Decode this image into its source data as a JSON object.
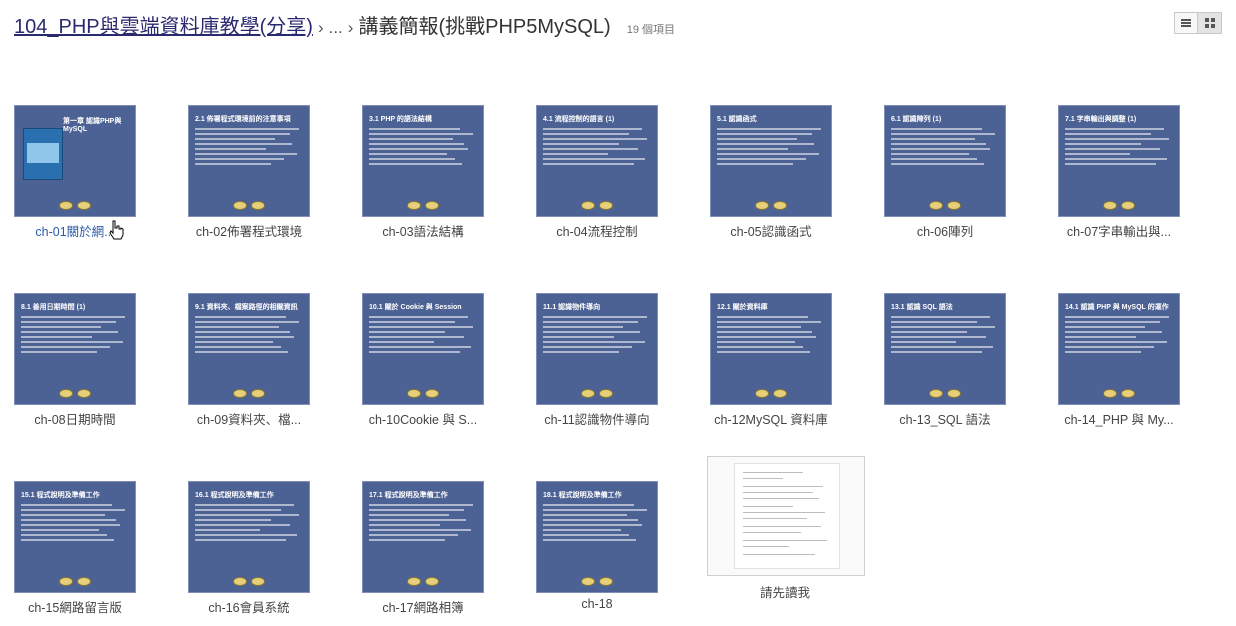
{
  "header": {
    "parent": "104_PHP與雲端資料庫教學(分享)",
    "sep1": "›",
    "ellipsis": "...",
    "sep2": "›",
    "current": "講義簡報(挑戰PHP5MySQL)",
    "count": "19 個項目"
  },
  "view_modes": {
    "active": "grid",
    "icons": [
      "list-view-icon",
      "grid-view-icon"
    ]
  },
  "slides": [
    {
      "label": "ch-01關於網...",
      "title": "第一章 認識PHP與MySQL"
    },
    {
      "label": "ch-02佈署程式環境",
      "title": "2.1 佈署程式環境前的注意事項"
    },
    {
      "label": "ch-03語法結構",
      "title": "3.1 PHP 的語法結構"
    },
    {
      "label": "ch-04流程控制",
      "title": "4.1 流程控制的語言 (1)"
    },
    {
      "label": "ch-05認識函式",
      "title": "5.1 認識函式"
    },
    {
      "label": "ch-06陣列",
      "title": "6.1 認識陣列 (1)"
    },
    {
      "label": "ch-07字串輸出與...",
      "title": "7.1 字串輸出與調整 (1)"
    },
    {
      "label": "ch-08日期時間",
      "title": "8.1 善用日期時間 (1)"
    },
    {
      "label": "ch-09資料夾、檔...",
      "title": "9.1 資料夾、檔案路徑的相關資訊"
    },
    {
      "label": "ch-10Cookie 與 S...",
      "title": "10.1 關於 Cookie 與 Session"
    },
    {
      "label": "ch-11認識物件導向",
      "title": "11.1 認識物件導向"
    },
    {
      "label": "ch-12MySQL 資料庫",
      "title": "12.1 關於資料庫"
    },
    {
      "label": "ch-13_SQL 語法",
      "title": "13.1 認識 SQL 語法"
    },
    {
      "label": "ch-14_PHP 與 My...",
      "title": "14.1 認識 PHP 與 MySQL 的運作"
    },
    {
      "label": "ch-15網路留言版",
      "title": "15.1 程式說明及準備工作"
    },
    {
      "label": "ch-16會員系統",
      "title": "16.1 程式說明及準備工作"
    },
    {
      "label": "ch-17網路相簿",
      "title": "17.1 程式說明及準備工作"
    },
    {
      "label": "ch-18",
      "title": "18.1 程式說明及準備工作"
    }
  ],
  "document": {
    "label": "請先讀我"
  },
  "colors": {
    "slide_bg": "#4c6294",
    "accent": "#2a2a6e"
  }
}
